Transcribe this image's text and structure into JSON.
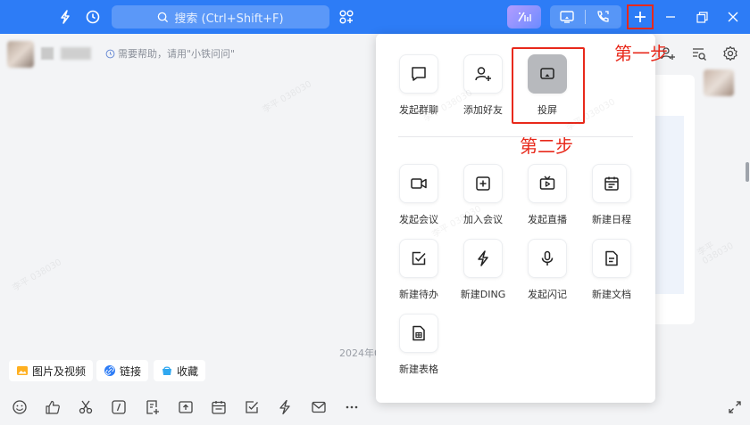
{
  "topbar": {
    "search_placeholder": "搜索 (Ctrl+Shift+F)",
    "icons": [
      "flash-icon",
      "history-icon",
      "apps-icon",
      "ai-icon",
      "screen-cast-icon",
      "phone-icon",
      "plus-icon",
      "minimize-icon",
      "restore-icon",
      "close-icon"
    ]
  },
  "chat_header": {
    "help_tip": "需要帮助，请用\"小铁问问\""
  },
  "chat": {
    "date_partial": "2024年0"
  },
  "chips": [
    {
      "label": "图片及视频",
      "icon": "image-icon"
    },
    {
      "label": "链接",
      "icon": "link-icon"
    },
    {
      "label": "收藏",
      "icon": "favorite-icon"
    }
  ],
  "dropdown": {
    "top_items": [
      {
        "label": "发起群聊",
        "icon": "chat-bubble-icon"
      },
      {
        "label": "添加好友",
        "icon": "add-user-icon"
      },
      {
        "label": "投屏",
        "icon": "screen-cast-icon"
      }
    ],
    "grid_items": [
      {
        "label": "发起会议",
        "icon": "video-icon"
      },
      {
        "label": "加入会议",
        "icon": "plus-square-icon"
      },
      {
        "label": "发起直播",
        "icon": "tv-icon"
      },
      {
        "label": "新建日程",
        "icon": "calendar-icon"
      },
      {
        "label": "新建待办",
        "icon": "check-square-icon"
      },
      {
        "label": "新建DING",
        "icon": "lightning-icon"
      },
      {
        "label": "发起闪记",
        "icon": "mic-icon"
      },
      {
        "label": "新建文档",
        "icon": "document-icon"
      },
      {
        "label": "新建表格",
        "icon": "spreadsheet-icon"
      }
    ]
  },
  "annotations": {
    "step1": "第一步",
    "step2": "第二步"
  },
  "watermark": "李平 038030",
  "colors": {
    "topbar": "#2d7cf6",
    "annotation_red": "#e8291b",
    "active_item": "#b7b9bd"
  }
}
